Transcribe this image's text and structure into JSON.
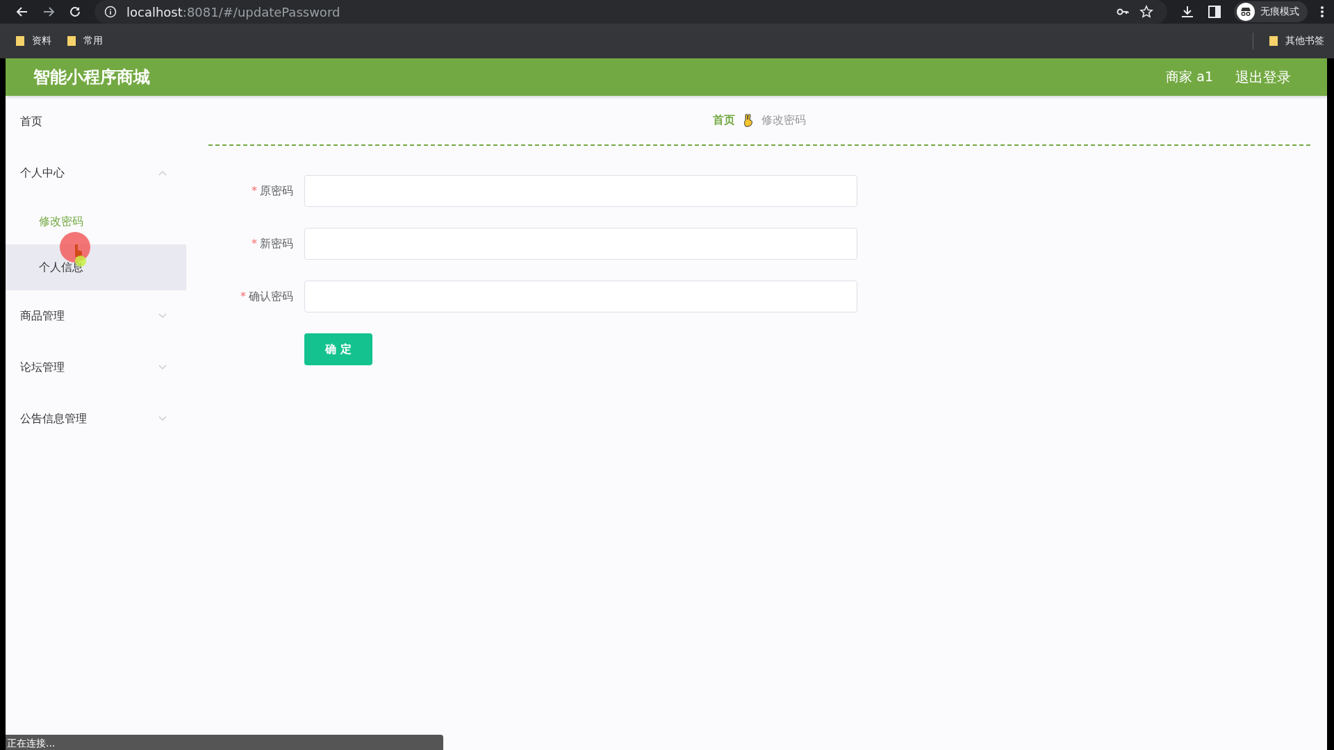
{
  "browser": {
    "url_host": "localhost",
    "url_path": ":8081/#/updatePassword",
    "profile_label": "无痕模式",
    "bookmarks": [
      "资料",
      "常用"
    ],
    "other_bookmarks": "其他书签"
  },
  "header": {
    "title": "智能小程序商城",
    "user": "商家 a1",
    "logout": "退出登录"
  },
  "sidebar": {
    "items": [
      {
        "label": "首页",
        "selected": false
      },
      {
        "label": "个人中心",
        "expanded": true,
        "children": [
          {
            "label": "修改密码",
            "selected": true,
            "hovered": false
          },
          {
            "label": "个人信息",
            "selected": false,
            "hovered": true
          }
        ]
      },
      {
        "label": "商品管理",
        "expanded": false
      },
      {
        "label": "论坛管理",
        "expanded": false
      },
      {
        "label": "公告信息管理",
        "expanded": false
      }
    ]
  },
  "breadcrumb": [
    {
      "label": "首页",
      "selected": false
    },
    {
      "label": "修改密码",
      "selected": true
    }
  ],
  "form": {
    "fields": [
      {
        "label": "原密码",
        "required_mark": "*"
      },
      {
        "label": "新密码",
        "required_mark": "*"
      },
      {
        "label": "确认密码",
        "required_mark": "*"
      }
    ],
    "submit": "确 定"
  },
  "status_bar": "正在连接..."
}
